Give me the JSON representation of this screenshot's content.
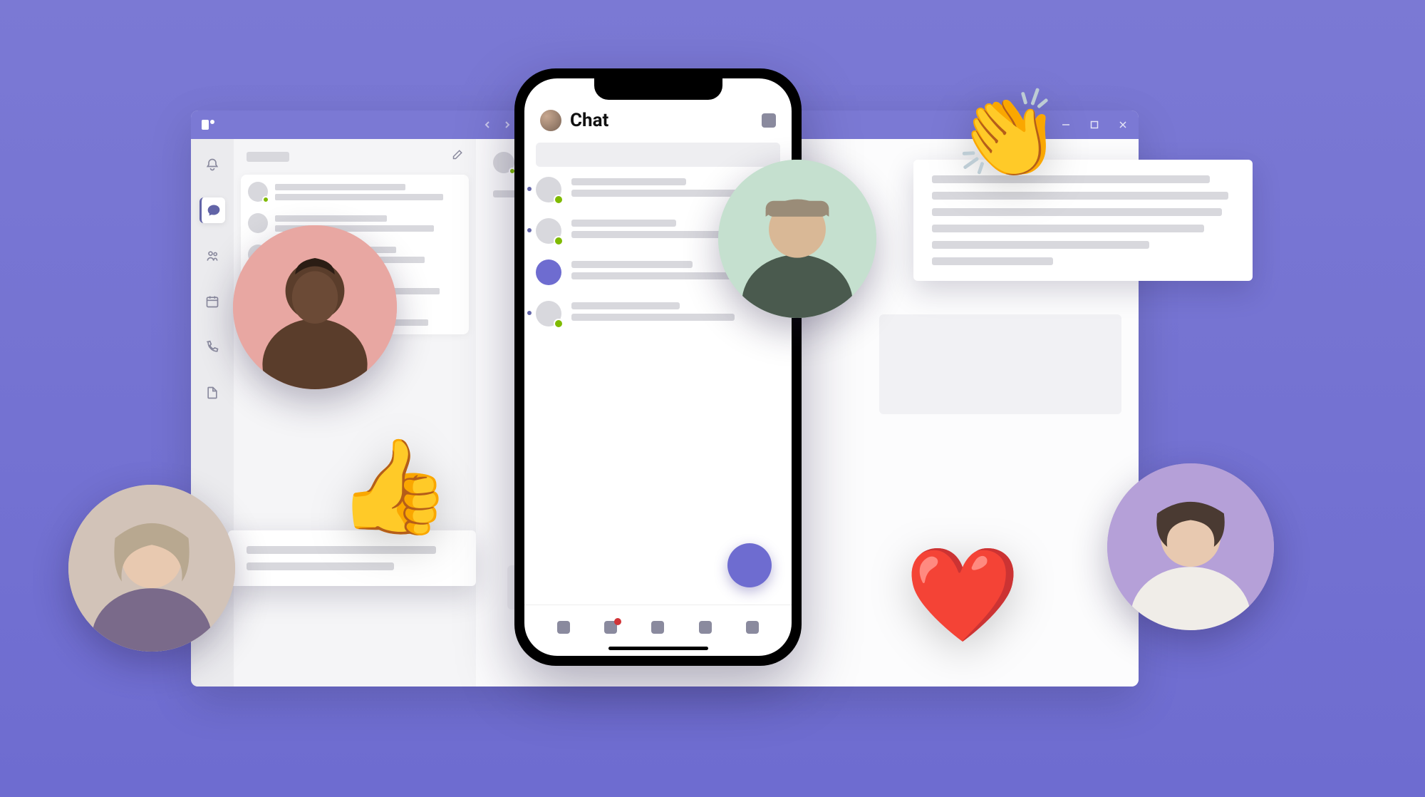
{
  "phone": {
    "title": "Chat",
    "tab_badge_index": 1
  },
  "desktop": {
    "rail_active_index": 1,
    "chat_items": 5,
    "tabs": 5
  },
  "avatars": [
    "avatar-person-1",
    "avatar-person-2",
    "avatar-person-3",
    "avatar-person-4"
  ],
  "reactions": {
    "thumbs": "👍",
    "clap": "👏",
    "heart": "❤️"
  },
  "colors": {
    "accent": "#6e6cd0",
    "presence_available": "#7fba00",
    "badge_red": "#d13438"
  }
}
